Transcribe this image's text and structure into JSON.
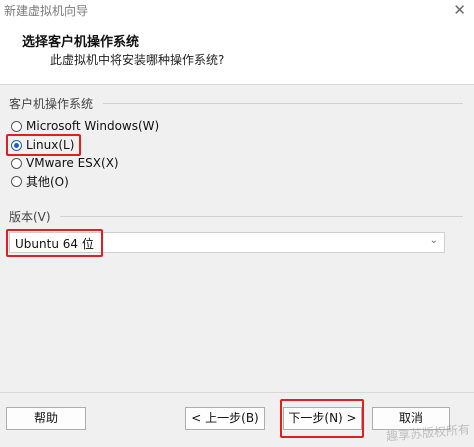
{
  "window": {
    "title": "新建虚拟机向导",
    "close_glyph": "✕"
  },
  "header": {
    "title": "选择客户机操作系统",
    "subtitle": "此虚拟机中将安装哪种操作系统?"
  },
  "os_group": {
    "label": "客户机操作系统",
    "options": [
      {
        "label": "Microsoft Windows(W)",
        "checked": false
      },
      {
        "label": "Linux(L)",
        "checked": true
      },
      {
        "label": "VMware ESX(X)",
        "checked": false
      },
      {
        "label": "其他(O)",
        "checked": false
      }
    ]
  },
  "version": {
    "label": "版本(V)",
    "selected": "Ubuntu 64 位"
  },
  "buttons": {
    "help": "帮助",
    "back": "< 上一步(B)",
    "next": "下一步(N) >",
    "cancel": "取消"
  },
  "watermark": "趣享苏版权所有",
  "colors": {
    "highlight": "#e02020",
    "radio_selected": "#1e5fc8"
  }
}
